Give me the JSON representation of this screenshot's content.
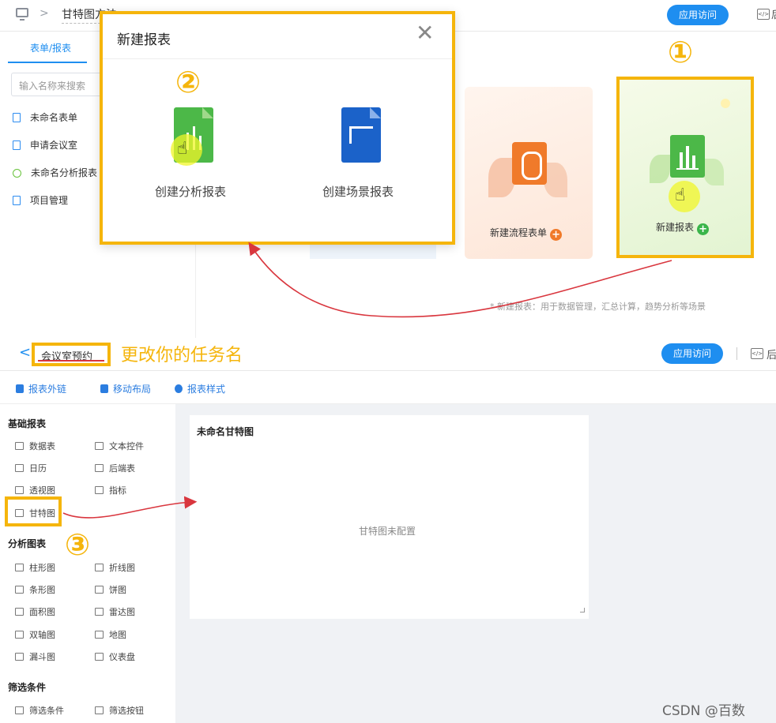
{
  "top": {
    "breadcrumb_title": "甘特图方法",
    "visit_button": "应用访问",
    "code_cut_char": "后",
    "sidebar_tab": "表单/报表",
    "search_placeholder": "输入名称来搜索",
    "items": [
      "未命名表单",
      "申请会议室",
      "未命名分析报表",
      "项目管理"
    ],
    "card_flow_label": "新建流程表单",
    "card_report_label": "新建报表",
    "hint": "* 新建报表：用于数据管理，汇总计算，趋势分析等场景"
  },
  "dialog": {
    "title": "新建报表",
    "close": "✕",
    "option_analysis": "创建分析报表",
    "option_scene": "创建场景报表"
  },
  "annotations": {
    "num1": "①",
    "num2": "②",
    "num3": "③",
    "rename_hint": "更改你的任务名"
  },
  "header2": {
    "back": "<",
    "app_name": "会议室预约",
    "visit_button": "应用访问",
    "code_cut_char": "后"
  },
  "toolbar2": {
    "items": [
      "报表外链",
      "移动布局",
      "报表样式"
    ]
  },
  "leftpanel": {
    "section_basic": "基础报表",
    "basic_items": [
      "数据表",
      "文本控件",
      "日历",
      "后端表",
      "透视图",
      "指标",
      "甘特图"
    ],
    "section_analysis": "分析图表",
    "analysis_items": [
      "柱形图",
      "折线图",
      "条形图",
      "饼图",
      "面积图",
      "雷达图",
      "双轴图",
      "地图",
      "漏斗图",
      "仪表盘"
    ],
    "section_filter": "筛选条件",
    "filter_items": [
      "筛选条件",
      "筛选按钮"
    ]
  },
  "canvas": {
    "card_title": "未命名甘特图",
    "card_message": "甘特图未配置"
  },
  "watermark": "CSDN @百数",
  "colors": {
    "accent_blue": "#1e8ef0",
    "highlight_yellow": "#f5b50c",
    "arrow_red": "#d9363e"
  }
}
